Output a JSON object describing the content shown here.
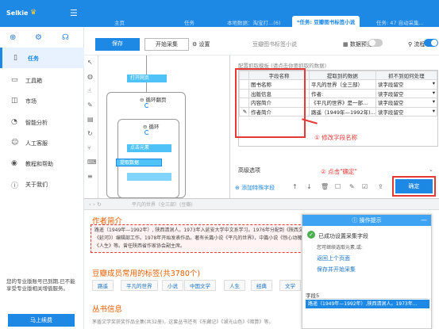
{
  "app": {
    "name": "Selkie",
    "colors": {
      "primary": "#1e88e5",
      "highlight": "#e53935",
      "heading": "#e35d00"
    }
  },
  "sidebar": {
    "logo": "Selkie",
    "top_icons": [
      "plus-circle-icon",
      "gear-icon",
      "headset-icon"
    ],
    "items": [
      {
        "label": "任务",
        "icon": "document-icon",
        "active": true
      },
      {
        "label": "工具箱",
        "icon": "toolbox-icon"
      },
      {
        "label": "市场",
        "icon": "bag-icon"
      },
      {
        "label": "智能分析",
        "icon": "chart-icon"
      },
      {
        "label": "人工客服",
        "icon": "user-icon"
      },
      {
        "label": "教程和帮助",
        "icon": "help-icon"
      },
      {
        "label": "关于我们",
        "icon": "info-icon"
      }
    ],
    "footer_text": "您的专业版账号已到期,已不能享受专业版相关增值服务。",
    "renew_button": "马上续费"
  },
  "tabs": [
    {
      "label": "主页"
    },
    {
      "label": "任务"
    },
    {
      "label": "本地数据：淘宝打...(6)"
    },
    {
      "label": "*任务: 豆瓣图书标签小说",
      "active": true
    },
    {
      "label": "任务: 47 自动采集..."
    }
  ],
  "toolbar": {
    "save": "保存",
    "start": "开始采集",
    "settings": "设置",
    "task_title": "豆瓣图书标签小说",
    "data_preview": "数据预览",
    "flow": "流程",
    "data_preview_on": false,
    "flow_on": true
  },
  "flow": {
    "open_page": "打开网页",
    "loop_page": "循环翻页",
    "loop": "循环",
    "click_element": "点击元素",
    "extract_data": "提取数据"
  },
  "config": {
    "title": "配置抓取模板 (请点击你要抓取的数据)",
    "headers": [
      "字段名称",
      "提取到的数据",
      "抓不到如何处理"
    ],
    "rows": [
      {
        "name": "图书名称",
        "data": "平凡的世界（全三部）",
        "handle": "读字段留空"
      },
      {
        "name": "出版信息",
        "data": "作者:",
        "handle": "读字段留空"
      },
      {
        "name": "内容简介",
        "data": "《平凡的世界》是一部...",
        "handle": "读字段留空"
      },
      {
        "name": "作者简介",
        "data": "路遥（1949年—1992年)...",
        "handle": "读字段留空"
      }
    ],
    "annotation1": "① 修改字段名称",
    "annotation2": "② 点击\"确定\"",
    "advanced": "高级选项",
    "add_field": "添加特殊字段",
    "ok": "确定"
  },
  "preview": {
    "url": "平凡的世界（全三部）(豆瓣)",
    "author_heading": "作者简介",
    "author_text": "路遥（1949年—1992年）, 陕西清涧人。1973年入延安大学中文系学习。1976年分配到《陕西文艺》（今《延河》）编辑部工作。1978年开始发表作品。著有长篇小说《平凡的世界》，中篇小说《惊心动魄的一幕》《人生》等。曾任陕西省作家协会副主席。",
    "tags_heading": "豆瓣成员常用的标签(共3780个)",
    "tags": [
      "路遥",
      "平凡的世界",
      "小说",
      "中国文学",
      "人生",
      "经典",
      "文学"
    ],
    "series_heading": "丛书信息",
    "series_text": "茅盾文学奖获奖作品全集(共32册)，这套丛书还有《东藏记》《湖光山色》《暗算》等。"
  },
  "operation_tip": {
    "title": "操作提示",
    "status": "已成功设置采集字段",
    "hint": "您可继续选取元素,或:",
    "links": [
      "返回上个页面",
      "保存并开始采集"
    ],
    "field_label": "字段5",
    "field_value": "路遥（1949年—1992年）,陕西清涧人。1973年..."
  }
}
